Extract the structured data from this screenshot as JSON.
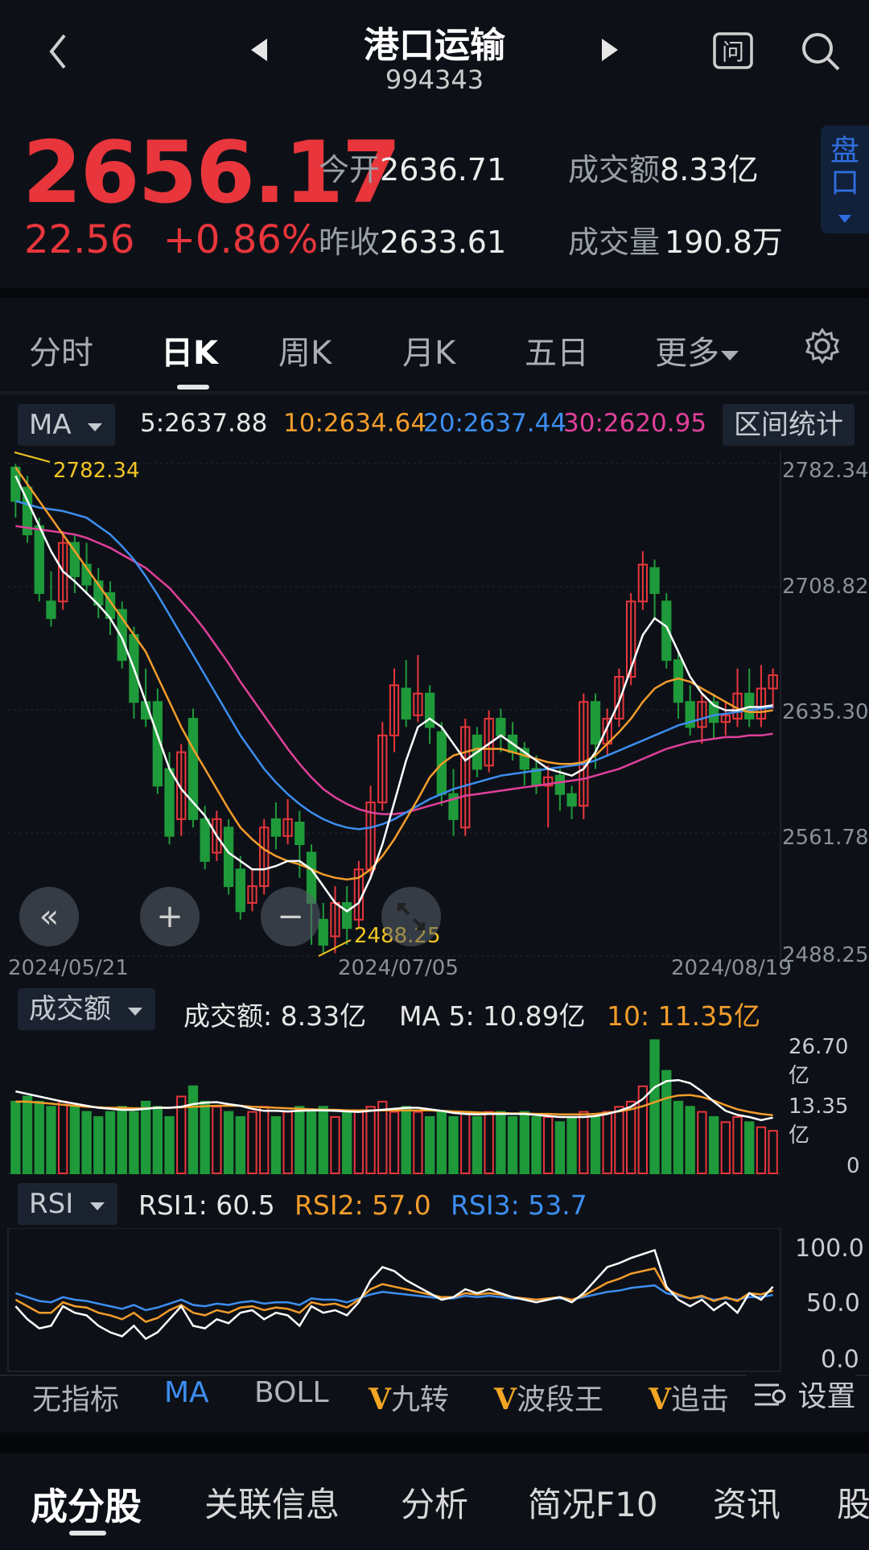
{
  "header": {
    "title": "港口运输",
    "code": "994343"
  },
  "quote": {
    "price": "2656.17",
    "change": "22.56",
    "change_pct": "+0.86%",
    "open_label": "今开",
    "open": "2636.71",
    "prev_close_label": "昨收",
    "prev_close": "2633.61",
    "turnover_label": "成交额",
    "turnover": "8.33亿",
    "volume_label": "成交量",
    "volume": "190.8万",
    "pankou": "盘口"
  },
  "tabs": [
    "分时",
    "日K",
    "周K",
    "月K",
    "五日",
    "更多"
  ],
  "ma_legend": {
    "selector": "MA",
    "ma5": "5:2637.88",
    "ma10": "10:2634.64",
    "ma20": "20:2637.44",
    "ma30": "30:2620.95",
    "range_button": "区间统计"
  },
  "kline": {
    "yticks": [
      "2782.34",
      "2708.82",
      "2635.30",
      "2561.78",
      "2488.25"
    ],
    "high_mark": "2782.34",
    "low_mark": "2488.25",
    "dates": [
      "2024/05/21",
      "2024/07/05",
      "2024/08/19"
    ]
  },
  "volume_panel": {
    "selector": "成交额",
    "value": "成交额: 8.33亿",
    "ma5": "MA 5: 10.89亿",
    "ma10": "10: 11.35亿",
    "yticks": [
      "26.70亿",
      "13.35亿",
      "0"
    ]
  },
  "rsi_panel": {
    "selector": "RSI",
    "rsi1": "RSI1: 60.5",
    "rsi2": "RSI2: 57.0",
    "rsi3": "RSI3: 53.7",
    "yticks": [
      "100.0",
      "50.0",
      "0.0"
    ]
  },
  "indicator_bar": {
    "items": [
      "无指标",
      "MA",
      "BOLL",
      "九转",
      "波段王",
      "追击"
    ],
    "settings": "设置"
  },
  "bottom_tabs": [
    "成分股",
    "关联信息",
    "分析",
    "简况F10",
    "资讯",
    "股"
  ],
  "colors": {
    "up": "#e8363c",
    "down": "#1f9a3a",
    "ma5": "#ffffff",
    "ma10": "#f39c2b",
    "ma20": "#3d8ef0",
    "ma30": "#e0409a",
    "bg": "#0d1117"
  },
  "chart_data": {
    "type": "candlestick",
    "yrange": [
      2488.25,
      2782.34
    ],
    "candles": [
      [
        2780,
        2760,
        2782,
        2750
      ],
      [
        2768,
        2740,
        2775,
        2735
      ],
      [
        2745,
        2705,
        2750,
        2700
      ],
      [
        2700,
        2690,
        2718,
        2685
      ],
      [
        2700,
        2735,
        2742,
        2695
      ],
      [
        2735,
        2715,
        2740,
        2705
      ],
      [
        2722,
        2710,
        2735,
        2705
      ],
      [
        2712,
        2698,
        2720,
        2690
      ],
      [
        2705,
        2690,
        2712,
        2680
      ],
      [
        2695,
        2665,
        2700,
        2660
      ],
      [
        2680,
        2640,
        2685,
        2630
      ],
      [
        2640,
        2630,
        2660,
        2625
      ],
      [
        2640,
        2590,
        2648,
        2585
      ],
      [
        2600,
        2560,
        2610,
        2555
      ],
      [
        2570,
        2610,
        2615,
        2560
      ],
      [
        2630,
        2570,
        2636,
        2565
      ],
      [
        2570,
        2545,
        2578,
        2540
      ],
      [
        2550,
        2570,
        2575,
        2545
      ],
      [
        2565,
        2530,
        2570,
        2525
      ],
      [
        2540,
        2515,
        2548,
        2510
      ],
      [
        2520,
        2530,
        2540,
        2515
      ],
      [
        2530,
        2565,
        2570,
        2525
      ],
      [
        2570,
        2560,
        2580,
        2552
      ],
      [
        2560,
        2570,
        2582,
        2555
      ],
      [
        2568,
        2555,
        2575,
        2535
      ],
      [
        2550,
        2520,
        2555,
        2495
      ],
      [
        2510,
        2495,
        2520,
        2490
      ],
      [
        2500,
        2520,
        2530,
        2490
      ],
      [
        2520,
        2505,
        2530,
        2495
      ],
      [
        2510,
        2540,
        2545,
        2505
      ],
      [
        2540,
        2580,
        2590,
        2535
      ],
      [
        2580,
        2620,
        2628,
        2575
      ],
      [
        2620,
        2650,
        2660,
        2610
      ],
      [
        2648,
        2630,
        2665,
        2625
      ],
      [
        2632,
        2645,
        2668,
        2628
      ],
      [
        2645,
        2625,
        2650,
        2615
      ],
      [
        2622,
        2585,
        2628,
        2578
      ],
      [
        2585,
        2570,
        2600,
        2560
      ],
      [
        2565,
        2625,
        2630,
        2560
      ],
      [
        2620,
        2600,
        2625,
        2595
      ],
      [
        2602,
        2630,
        2635,
        2598
      ],
      [
        2630,
        2620,
        2636,
        2610
      ],
      [
        2620,
        2610,
        2628,
        2605
      ],
      [
        2612,
        2600,
        2616,
        2590
      ],
      [
        2600,
        2590,
        2608,
        2585
      ],
      [
        2590,
        2595,
        2602,
        2565
      ],
      [
        2596,
        2585,
        2600,
        2575
      ],
      [
        2585,
        2578,
        2590,
        2570
      ],
      [
        2578,
        2640,
        2645,
        2570
      ],
      [
        2640,
        2615,
        2645,
        2600
      ],
      [
        2615,
        2630,
        2636,
        2608
      ],
      [
        2630,
        2655,
        2660,
        2625
      ],
      [
        2655,
        2700,
        2705,
        2650
      ],
      [
        2700,
        2722,
        2730,
        2695
      ],
      [
        2720,
        2705,
        2725,
        2690
      ],
      [
        2700,
        2665,
        2705,
        2660
      ],
      [
        2665,
        2640,
        2670,
        2630
      ],
      [
        2640,
        2625,
        2650,
        2620
      ],
      [
        2625,
        2640,
        2645,
        2615
      ],
      [
        2640,
        2628,
        2645,
        2618
      ],
      [
        2628,
        2632,
        2640,
        2620
      ],
      [
        2630,
        2645,
        2660,
        2625
      ],
      [
        2645,
        2630,
        2660,
        2625
      ],
      [
        2630,
        2648,
        2662,
        2625
      ],
      [
        2648,
        2656,
        2660,
        2636
      ]
    ],
    "ma5": [
      2775,
      2760,
      2745,
      2730,
      2718,
      2712,
      2705,
      2698,
      2690,
      2678,
      2660,
      2640,
      2620,
      2600,
      2588,
      2580,
      2572,
      2560,
      2550,
      2545,
      2540,
      2540,
      2542,
      2545,
      2545,
      2540,
      2530,
      2520,
      2515,
      2520,
      2535,
      2555,
      2580,
      2605,
      2625,
      2630,
      2625,
      2615,
      2605,
      2610,
      2615,
      2620,
      2615,
      2610,
      2605,
      2600,
      2598,
      2596,
      2600,
      2610,
      2625,
      2640,
      2660,
      2680,
      2690,
      2685,
      2670,
      2655,
      2645,
      2638,
      2635,
      2635,
      2637,
      2637,
      2638
    ],
    "ma10": [
      2780,
      2770,
      2760,
      2750,
      2740,
      2730,
      2720,
      2710,
      2700,
      2690,
      2680,
      2670,
      2655,
      2640,
      2625,
      2612,
      2600,
      2588,
      2576,
      2565,
      2558,
      2552,
      2548,
      2545,
      2543,
      2540,
      2537,
      2535,
      2534,
      2535,
      2540,
      2548,
      2558,
      2570,
      2582,
      2595,
      2603,
      2608,
      2610,
      2612,
      2612,
      2612,
      2610,
      2608,
      2606,
      2604,
      2603,
      2603,
      2604,
      2608,
      2615,
      2622,
      2630,
      2640,
      2648,
      2652,
      2654,
      2652,
      2648,
      2644,
      2640,
      2636,
      2634,
      2634,
      2635
    ],
    "ma20": [
      2760,
      2758,
      2756,
      2755,
      2754,
      2752,
      2750,
      2745,
      2740,
      2733,
      2725,
      2715,
      2704,
      2692,
      2680,
      2668,
      2656,
      2644,
      2632,
      2620,
      2610,
      2600,
      2592,
      2585,
      2579,
      2574,
      2570,
      2567,
      2565,
      2564,
      2565,
      2567,
      2570,
      2574,
      2578,
      2582,
      2585,
      2588,
      2590,
      2592,
      2594,
      2596,
      2597,
      2598,
      2599,
      2600,
      2601,
      2602,
      2603,
      2605,
      2608,
      2611,
      2614,
      2617,
      2620,
      2623,
      2626,
      2628,
      2630,
      2632,
      2633,
      2634,
      2635,
      2636,
      2637
    ],
    "ma30": [
      2745,
      2744,
      2743,
      2742,
      2741,
      2740,
      2738,
      2735,
      2732,
      2728,
      2724,
      2720,
      2714,
      2708,
      2700,
      2692,
      2683,
      2673,
      2663,
      2652,
      2642,
      2632,
      2622,
      2612,
      2603,
      2595,
      2588,
      2583,
      2579,
      2576,
      2574,
      2573,
      2573,
      2574,
      2576,
      2578,
      2580,
      2582,
      2584,
      2585,
      2586,
      2587,
      2588,
      2589,
      2590,
      2591,
      2592,
      2593,
      2594,
      2596,
      2598,
      2600,
      2603,
      2606,
      2609,
      2612,
      2614,
      2616,
      2617,
      2618,
      2619,
      2619,
      2620,
      2620,
      2621
    ],
    "volume_range": [
      0,
      26.7
    ],
    "volume": [
      14,
      15,
      14,
      13,
      14,
      13,
      12,
      11,
      12,
      13,
      12,
      14,
      13,
      11,
      15,
      17,
      14,
      13,
      12,
      11,
      12,
      13,
      11,
      12,
      13,
      12,
      13,
      11,
      12,
      12,
      13,
      14,
      12,
      13,
      12,
      11,
      12,
      11,
      12,
      11,
      12,
      12,
      11,
      12,
      11,
      11,
      10,
      11,
      12,
      11,
      12,
      13,
      14,
      17,
      26,
      20,
      14,
      13,
      12,
      11,
      10,
      11,
      10,
      9,
      8.3
    ],
    "vol_ma5": [
      16,
      15.5,
      15,
      14.5,
      14,
      13.6,
      13.2,
      12.8,
      12.6,
      12.4,
      12.4,
      12.6,
      12.8,
      12.8,
      13,
      13.5,
      13.8,
      13.9,
      13.5,
      13.2,
      12.6,
      12.2,
      12.2,
      12.1,
      12.2,
      12.3,
      12.3,
      12.2,
      12.1,
      12,
      12.2,
      12.4,
      12.6,
      12.8,
      12.8,
      12.5,
      12.2,
      11.8,
      11.6,
      11.5,
      11.6,
      11.6,
      11.6,
      11.6,
      11.4,
      11.2,
      11,
      11,
      11,
      11.2,
      11.6,
      12.2,
      13,
      14.5,
      16.8,
      18,
      18.2,
      17.6,
      16,
      14,
      12.2,
      11.4,
      11,
      10.4,
      10.89
    ],
    "vol_ma10": [
      14,
      14,
      13.8,
      13.6,
      13.4,
      13.2,
      13,
      12.9,
      12.8,
      12.8,
      12.7,
      12.7,
      12.8,
      12.8,
      12.9,
      13,
      13.1,
      13.2,
      13.2,
      13.2,
      13,
      12.9,
      12.8,
      12.7,
      12.6,
      12.5,
      12.4,
      12.4,
      12.3,
      12.3,
      12.3,
      12.3,
      12.3,
      12.3,
      12.3,
      12.3,
      12.2,
      12.1,
      12,
      11.9,
      11.8,
      11.8,
      11.7,
      11.7,
      11.6,
      11.6,
      11.5,
      11.5,
      11.5,
      11.6,
      11.8,
      12.1,
      12.5,
      13.1,
      13.9,
      14.7,
      15.2,
      15.3,
      14.9,
      14.2,
      13.3,
      12.5,
      12,
      11.6,
      11.35
    ],
    "rsi_range": [
      0,
      100
    ],
    "rsi1": [
      45,
      35,
      28,
      30,
      45,
      40,
      38,
      30,
      25,
      22,
      30,
      20,
      25,
      35,
      45,
      30,
      28,
      35,
      32,
      40,
      42,
      35,
      40,
      38,
      30,
      45,
      40,
      42,
      38,
      48,
      65,
      75,
      72,
      65,
      60,
      55,
      50,
      52,
      58,
      55,
      58,
      55,
      52,
      50,
      48,
      50,
      52,
      48,
      55,
      65,
      75,
      78,
      82,
      85,
      88,
      60,
      50,
      45,
      50,
      42,
      48,
      40,
      55,
      50,
      60
    ],
    "rsi2": [
      50,
      45,
      40,
      40,
      48,
      45,
      44,
      40,
      38,
      35,
      40,
      33,
      36,
      42,
      46,
      40,
      38,
      42,
      40,
      44,
      45,
      42,
      44,
      43,
      40,
      48,
      46,
      47,
      44,
      50,
      58,
      62,
      60,
      58,
      56,
      54,
      52,
      52,
      55,
      54,
      55,
      54,
      52,
      51,
      50,
      51,
      52,
      50,
      53,
      58,
      63,
      66,
      70,
      72,
      74,
      58,
      54,
      51,
      53,
      49,
      52,
      49,
      55,
      54,
      57
    ],
    "rsi3": [
      55,
      52,
      49,
      48,
      52,
      50,
      49,
      47,
      45,
      43,
      46,
      42,
      44,
      47,
      50,
      46,
      45,
      47,
      46,
      48,
      49,
      47,
      48,
      48,
      46,
      51,
      50,
      50,
      48,
      51,
      54,
      56,
      55,
      54,
      53,
      52,
      51,
      51,
      53,
      52,
      53,
      52,
      51,
      51,
      50,
      51,
      51,
      50,
      52,
      54,
      56,
      57,
      59,
      60,
      61,
      55,
      53,
      51,
      52,
      50,
      51,
      50,
      52,
      52,
      53.7
    ]
  }
}
